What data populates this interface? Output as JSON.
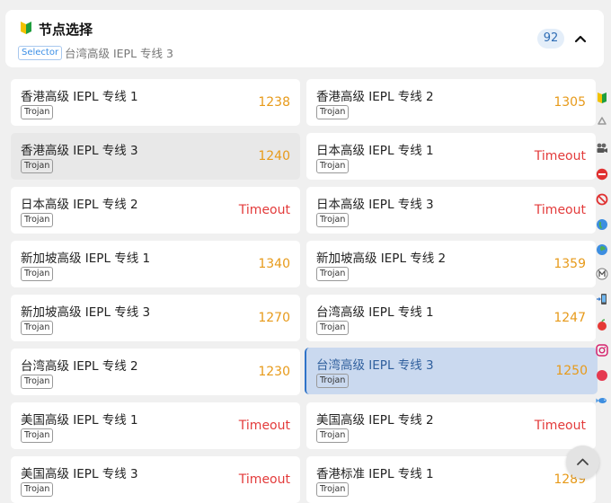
{
  "header": {
    "title": "节点选择",
    "type_tag": "Selector",
    "current": "台湾高级 IEPL 专线 3",
    "count": "92",
    "icon": "beginner-leaf-icon",
    "collapse_icon": "chevron-up-icon"
  },
  "colors": {
    "delay_ok": "#e79a1a",
    "delay_timeout": "#e33b3b",
    "selected_bg": "#cad9ef",
    "selected_border": "#2f73c8",
    "type_tag": "#3a8ee6"
  },
  "nodes": [
    {
      "name": "香港高级 IEPL 专线 1",
      "type": "Trojan",
      "delay": "1238"
    },
    {
      "name": "香港高级 IEPL 专线 2",
      "type": "Trojan",
      "delay": "1305"
    },
    {
      "name": "香港高级 IEPL 专线 3",
      "type": "Trojan",
      "delay": "1240"
    },
    {
      "name": "日本高级 IEPL 专线 1",
      "type": "Trojan",
      "delay": "Timeout"
    },
    {
      "name": "日本高级 IEPL 专线 2",
      "type": "Trojan",
      "delay": "Timeout"
    },
    {
      "name": "日本高级 IEPL 专线 3",
      "type": "Trojan",
      "delay": "Timeout"
    },
    {
      "name": "新加坡高级 IEPL 专线 1",
      "type": "Trojan",
      "delay": "1340"
    },
    {
      "name": "新加坡高级 IEPL 专线 2",
      "type": "Trojan",
      "delay": "1359"
    },
    {
      "name": "新加坡高级 IEPL 专线 3",
      "type": "Trojan",
      "delay": "1270"
    },
    {
      "name": "台湾高级 IEPL 专线 1",
      "type": "Trojan",
      "delay": "1247"
    },
    {
      "name": "台湾高级 IEPL 专线 2",
      "type": "Trojan",
      "delay": "1230"
    },
    {
      "name": "台湾高级 IEPL 专线 3",
      "type": "Trojan",
      "delay": "1250"
    },
    {
      "name": "美国高级 IEPL 专线 1",
      "type": "Trojan",
      "delay": "Timeout"
    },
    {
      "name": "美国高级 IEPL 专线 2",
      "type": "Trojan",
      "delay": "Timeout"
    },
    {
      "name": "美国高级 IEPL 专线 3",
      "type": "Trojan",
      "delay": "Timeout"
    },
    {
      "name": "香港标准 IEPL 专线 1",
      "type": "Trojan",
      "delay": "1289"
    }
  ],
  "side_rail": [
    "beginner-leaf-icon",
    "recycle-icon",
    "film-camera-icon",
    "no-entry-icon",
    "prohibited-icon",
    "globe-americas-icon",
    "globe-asia-icon",
    "metro-m-icon",
    "phone-arrow-icon",
    "apple-icon",
    "instagram-icon",
    "red-circle-icon",
    "fish-icon"
  ],
  "scroll_top_icon": "chevron-up-icon"
}
